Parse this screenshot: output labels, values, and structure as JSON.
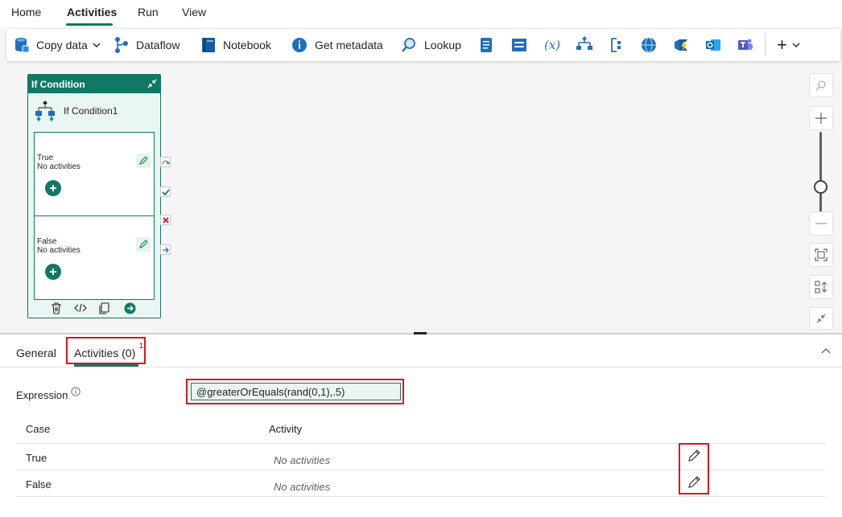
{
  "menu": {
    "items": [
      {
        "label": "Home"
      },
      {
        "label": "Activities"
      },
      {
        "label": "Run"
      },
      {
        "label": "View"
      }
    ],
    "active": "Activities"
  },
  "toolbar": {
    "copy_data": "Copy data",
    "dataflow": "Dataflow",
    "notebook": "Notebook",
    "get_metadata": "Get metadata",
    "lookup": "Lookup",
    "icon_buttons": [
      "script-icon",
      "set-variable-icon",
      "expression-variable-icon",
      "switch-icon",
      "foreach-icon",
      "web-icon",
      "azure-function-icon",
      "outlook-icon",
      "teams-icon"
    ],
    "more": "+"
  },
  "node": {
    "header": "If Condition",
    "name": "If Condition1",
    "true_branch": {
      "label": "True",
      "status": "No activities"
    },
    "false_branch": {
      "label": "False",
      "status": "No activities"
    }
  },
  "panel": {
    "tabs": [
      {
        "label": "General"
      },
      {
        "label": "Activities (0)",
        "badge": "1"
      }
    ],
    "expression_label": "Expression",
    "expression_value": "@greaterOrEquals(rand(0,1),.5)",
    "table": {
      "headers": {
        "case": "Case",
        "activity": "Activity"
      },
      "rows": [
        {
          "case": "True",
          "activity": "No activities"
        },
        {
          "case": "False",
          "activity": "No activities"
        }
      ]
    }
  },
  "colors": {
    "accent": "#117865",
    "highlight": "#e0151b",
    "node_fill": "#e9f6f1"
  }
}
